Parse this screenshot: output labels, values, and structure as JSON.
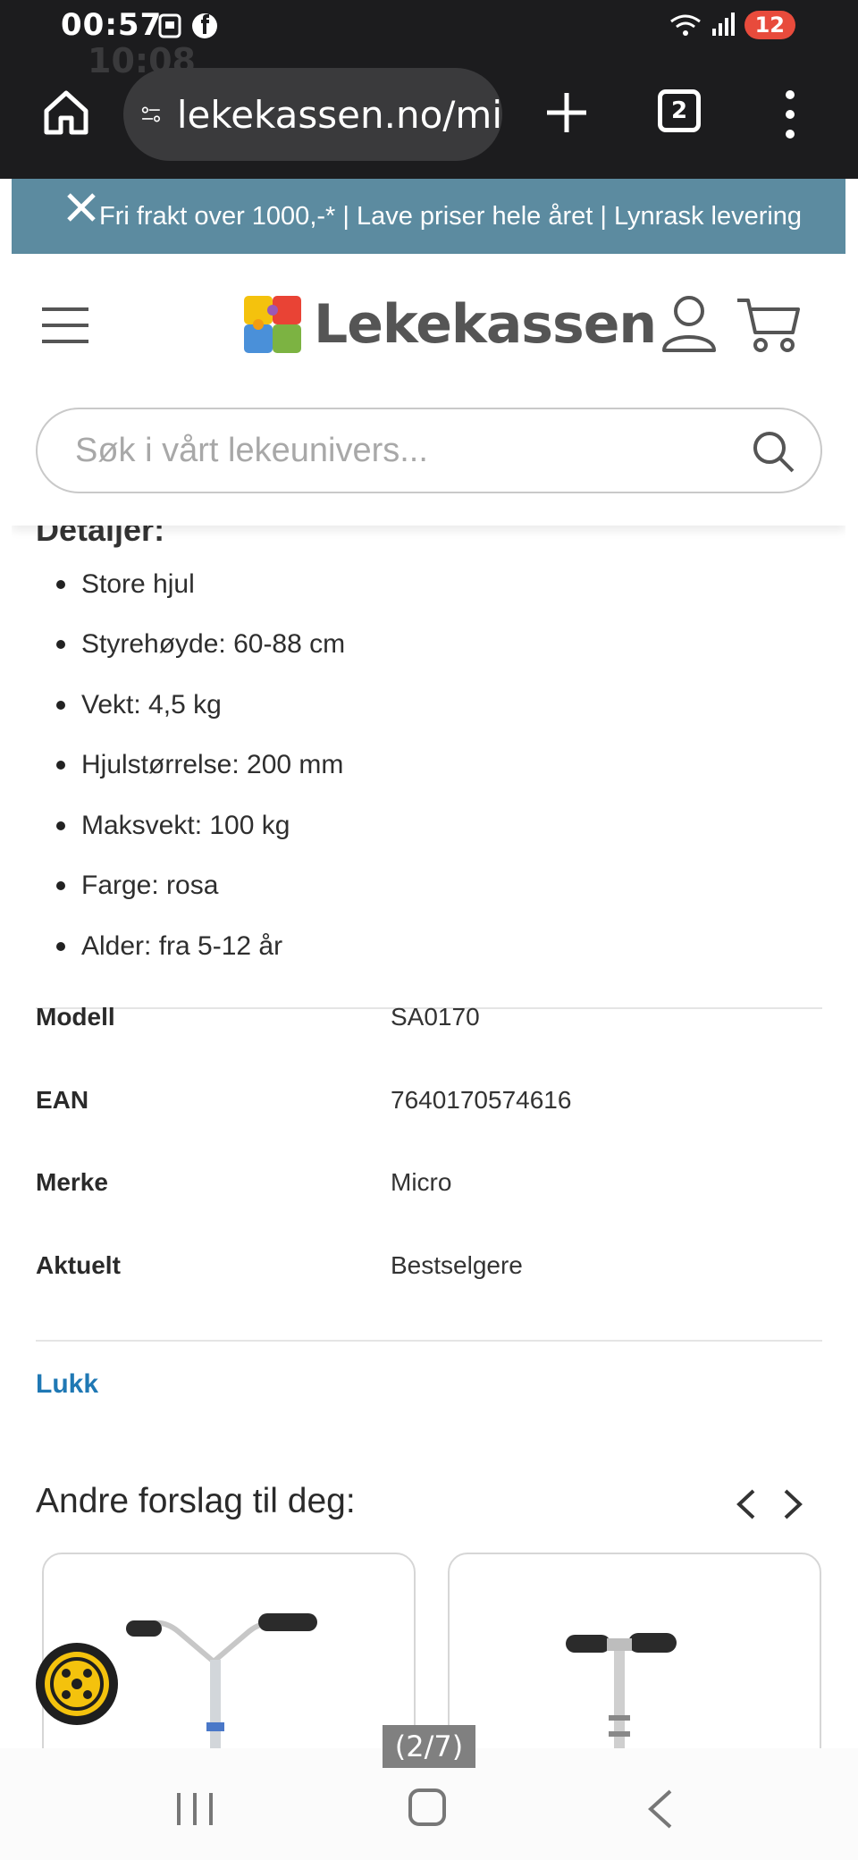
{
  "status_bar": {
    "time": "00:57",
    "ghost_time": "10:08",
    "battery": "12"
  },
  "browser": {
    "url": "lekekassen.no/mi",
    "tab_count": "2"
  },
  "promo_bar": {
    "text": "Fri frakt over 1000,-* | Lave priser hele året | Lynrask levering"
  },
  "header": {
    "logo_text": "Lekekassen",
    "search_placeholder": "Søk i vårt lekeunivers..."
  },
  "details": {
    "heading": "Detaljer:",
    "items": [
      "Store hjul",
      "Styrehøyde: 60-88 cm",
      "Vekt: 4,5 kg",
      "Hjulstørrelse: 200 mm",
      "Maksvekt: 100 kg",
      "Farge: rosa",
      "Alder: fra 5-12 år"
    ]
  },
  "specs": [
    {
      "label": "Modell",
      "value": "SA0170"
    },
    {
      "label": "EAN",
      "value": "7640170574616"
    },
    {
      "label": "Merke",
      "value": "Micro"
    },
    {
      "label": "Aktuelt",
      "value": "Bestselgere"
    }
  ],
  "close_link": "Lukk",
  "suggestions": {
    "title": "Andre forslag til deg:"
  },
  "image_counter": "(2/7)",
  "colors": {
    "promo_bg": "#5c8ba0",
    "link_blue": "#1f78b4",
    "fab_yellow": "#f4c20d"
  }
}
